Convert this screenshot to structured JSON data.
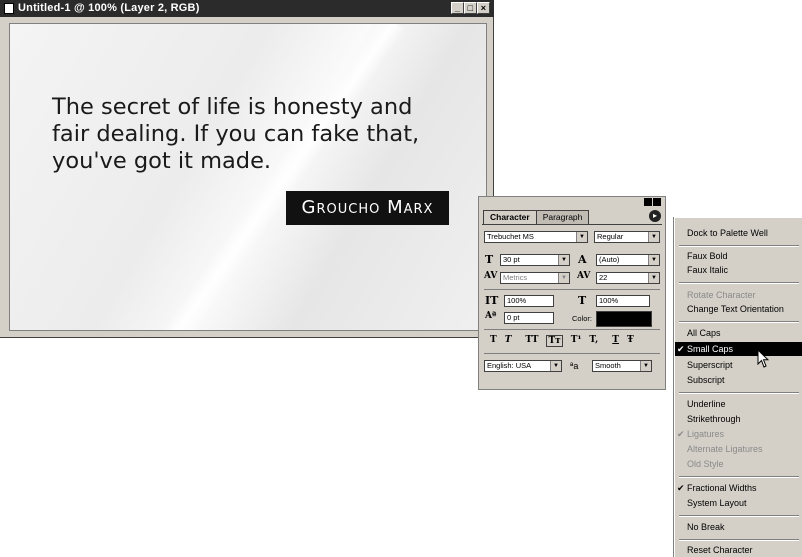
{
  "window": {
    "title": "Untitled-1 @ 100% (Layer 2, RGB)",
    "buttons": [
      "_",
      "□",
      "×"
    ]
  },
  "canvas": {
    "quote_lines": [
      "The secret of life is honesty and",
      "fair dealing. If you can fake that,",
      "you've got it made."
    ],
    "author": "Groucho Marx"
  },
  "palette": {
    "tabs": [
      "Character",
      "Paragraph"
    ],
    "font_family": "Trebuchet MS",
    "font_style": "Regular",
    "font_size": "30 pt",
    "leading": "(Auto)",
    "kerning": "Metrics",
    "tracking": "22",
    "vertical_scale": "100%",
    "horizontal_scale": "100%",
    "baseline_shift": "0 pt",
    "color_label": "Color:",
    "color_value": "#000000",
    "style_buttons": [
      "T",
      "T",
      "TT",
      "Tт",
      "T¹",
      "T,",
      "T",
      "Ŧ"
    ],
    "language": "English: USA",
    "aa_label": "ªa",
    "antialias": "Smooth"
  },
  "menu": {
    "items": [
      {
        "label": "Dock to Palette Well",
        "checked": false,
        "disabled": false
      },
      {
        "label": "Faux Bold",
        "checked": false,
        "disabled": false
      },
      {
        "label": "Faux Italic",
        "checked": false,
        "disabled": false
      },
      {
        "label": "Rotate Character",
        "checked": false,
        "disabled": true
      },
      {
        "label": "Change Text Orientation",
        "checked": false,
        "disabled": false
      },
      {
        "label": "All Caps",
        "checked": false,
        "disabled": false
      },
      {
        "label": "Small Caps",
        "checked": true,
        "disabled": false,
        "highlighted": true
      },
      {
        "label": "Superscript",
        "checked": false,
        "disabled": false
      },
      {
        "label": "Subscript",
        "checked": false,
        "disabled": false
      },
      {
        "label": "Underline",
        "checked": false,
        "disabled": false
      },
      {
        "label": "Strikethrough",
        "checked": false,
        "disabled": false
      },
      {
        "label": "Ligatures",
        "checked": true,
        "disabled": true
      },
      {
        "label": "Alternate Ligatures",
        "checked": false,
        "disabled": true
      },
      {
        "label": "Old Style",
        "checked": false,
        "disabled": true
      },
      {
        "label": "Fractional Widths",
        "checked": true,
        "disabled": false
      },
      {
        "label": "System Layout",
        "checked": false,
        "disabled": false
      },
      {
        "label": "No Break",
        "checked": false,
        "disabled": false
      },
      {
        "label": "Reset Character",
        "checked": false,
        "disabled": false
      }
    ]
  }
}
